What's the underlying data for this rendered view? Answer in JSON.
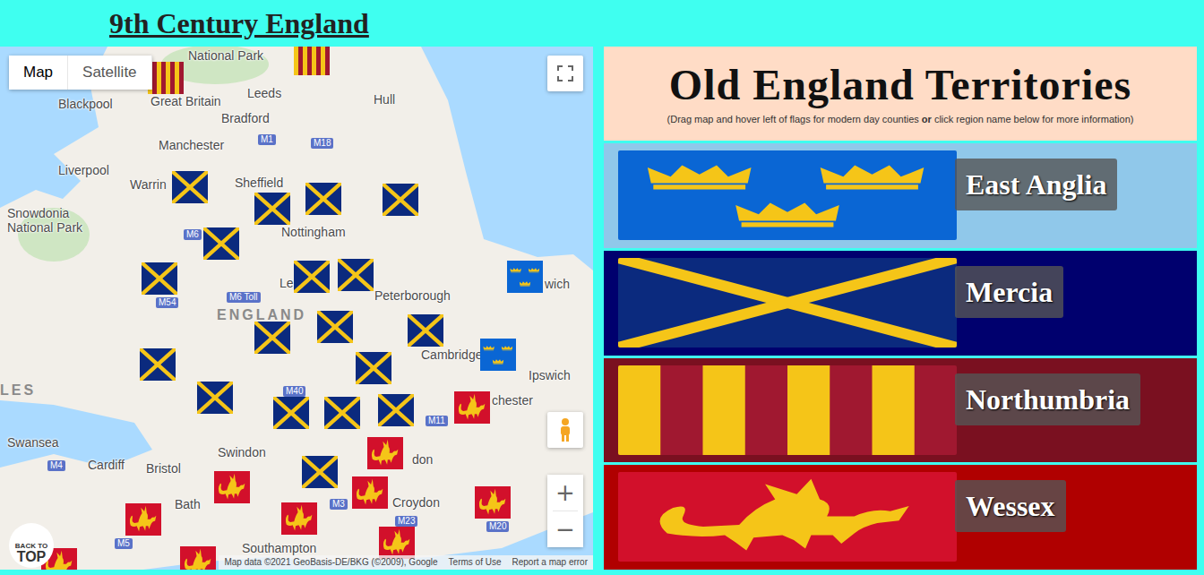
{
  "page": {
    "title": "9th Century England"
  },
  "map": {
    "types": [
      {
        "label": "Map",
        "selected": true
      },
      {
        "label": "Satellite",
        "selected": false
      }
    ],
    "cities": [
      {
        "name": "National Park"
      },
      {
        "name": "Leeds"
      },
      {
        "name": "Hull"
      },
      {
        "name": "Blackpool"
      },
      {
        "name": "Great Britain"
      },
      {
        "name": "Bradford"
      },
      {
        "name": "Manchester"
      },
      {
        "name": "Liverpool"
      },
      {
        "name": "Warrin"
      },
      {
        "name": "Sheffield"
      },
      {
        "name": "Snowdonia"
      },
      {
        "name": "National Park"
      },
      {
        "name": "Nottingham"
      },
      {
        "name": "Le"
      },
      {
        "name": "Peterborough"
      },
      {
        "name": "wich"
      },
      {
        "name": "Cambridge"
      },
      {
        "name": "Ipswich"
      },
      {
        "name": "chester"
      },
      {
        "name": "Swansea"
      },
      {
        "name": "Cardiff"
      },
      {
        "name": "Bristol"
      },
      {
        "name": "Swindon"
      },
      {
        "name": "Bath"
      },
      {
        "name": "don"
      },
      {
        "name": "Croydon"
      },
      {
        "name": "Southampton"
      }
    ],
    "regions": [
      "ENGLAND",
      "LES"
    ],
    "roads": [
      "M1",
      "M18",
      "M6",
      "M54",
      "M6 Toll",
      "M40",
      "M11",
      "M4",
      "M3",
      "M23",
      "M20",
      "M5"
    ],
    "pins": [
      {
        "kind": "northumbria"
      },
      {
        "kind": "northumbria"
      },
      {
        "kind": "mercia"
      },
      {
        "kind": "mercia"
      },
      {
        "kind": "mercia"
      },
      {
        "kind": "mercia"
      },
      {
        "kind": "mercia"
      },
      {
        "kind": "mercia"
      },
      {
        "kind": "mercia"
      },
      {
        "kind": "mercia"
      },
      {
        "kind": "mercia"
      },
      {
        "kind": "mercia"
      },
      {
        "kind": "mercia"
      },
      {
        "kind": "mercia"
      },
      {
        "kind": "mercia"
      },
      {
        "kind": "mercia"
      },
      {
        "kind": "mercia"
      },
      {
        "kind": "mercia"
      },
      {
        "kind": "mercia"
      },
      {
        "kind": "mercia"
      },
      {
        "kind": "eastanglia"
      },
      {
        "kind": "eastanglia"
      },
      {
        "kind": "wessex"
      },
      {
        "kind": "wessex"
      },
      {
        "kind": "wessex"
      },
      {
        "kind": "wessex"
      },
      {
        "kind": "wessex"
      },
      {
        "kind": "wessex"
      },
      {
        "kind": "wessex"
      },
      {
        "kind": "wessex"
      },
      {
        "kind": "wessex"
      },
      {
        "kind": "wessex"
      }
    ],
    "zoom": [
      "+",
      "−"
    ],
    "attribution": [
      "Map data ©2021 GeoBasis-DE/BKG (©2009), Google",
      "Terms of Use",
      "Report a map error"
    ],
    "backToTop": [
      "BACK TO",
      "TOP"
    ]
  },
  "panel": {
    "title": "Old England Territories",
    "subtitle": [
      {
        "text": "(Drag map and hover left of flags for modern day counties ",
        "bold": false
      },
      {
        "text": "or",
        "bold": true
      },
      {
        "text": " click region name below for more information)",
        "bold": false
      }
    ]
  },
  "territories": [
    {
      "name": "East Anglia",
      "kind": "eastanglia",
      "color": "#90c8ea"
    },
    {
      "name": "Mercia",
      "kind": "mercia",
      "color": "#00006e"
    },
    {
      "name": "Northumbria",
      "kind": "northumbria",
      "color": "#7a1020"
    },
    {
      "name": "Wessex",
      "kind": "wessex",
      "color": "#b00000"
    }
  ]
}
